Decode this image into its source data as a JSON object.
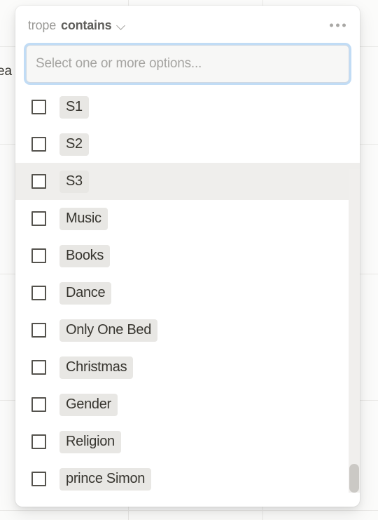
{
  "background": {
    "partial_cell_text": "ea"
  },
  "popup": {
    "header": {
      "property_name": "trope",
      "condition": "contains",
      "chevron_icon": "chevron-down-icon",
      "more_icon": "ellipsis-horizontal-icon"
    },
    "search": {
      "placeholder": "Select one or more options...",
      "value": ""
    },
    "options": [
      {
        "label": "S1",
        "checked": false,
        "hovered": false
      },
      {
        "label": "S2",
        "checked": false,
        "hovered": false
      },
      {
        "label": "S3",
        "checked": false,
        "hovered": true
      },
      {
        "label": "Music",
        "checked": false,
        "hovered": false
      },
      {
        "label": "Books",
        "checked": false,
        "hovered": false
      },
      {
        "label": "Dance",
        "checked": false,
        "hovered": false
      },
      {
        "label": "Only One Bed",
        "checked": false,
        "hovered": false
      },
      {
        "label": "Christmas",
        "checked": false,
        "hovered": false
      },
      {
        "label": "Gender",
        "checked": false,
        "hovered": false
      },
      {
        "label": "Religion",
        "checked": false,
        "hovered": false
      },
      {
        "label": "prince Simon",
        "checked": false,
        "hovered": false
      }
    ],
    "colors": {
      "focus_ring": "#76b2e9",
      "panel": "#ffffff",
      "pill": "#e8e7e4",
      "hover_row": "#efeeec",
      "scrollbar_thumb": "#cbc9c5"
    }
  }
}
